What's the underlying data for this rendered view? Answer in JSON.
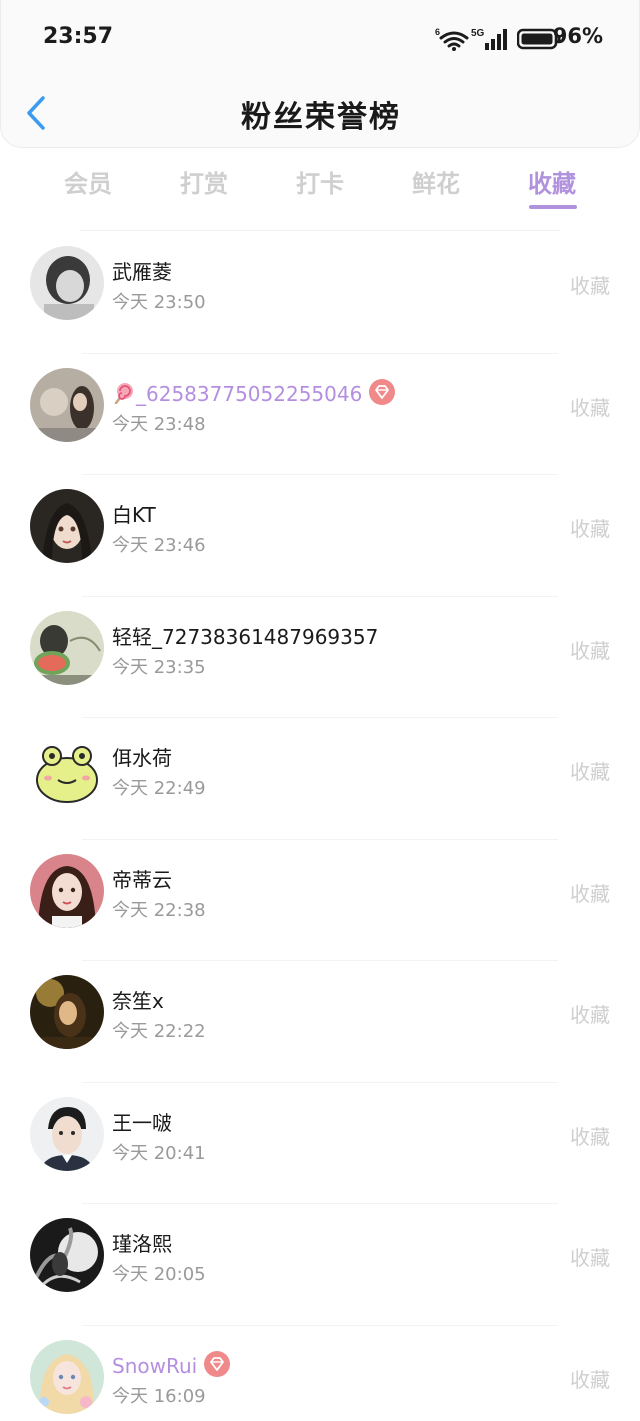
{
  "status": {
    "time": "23:57",
    "network": "5G",
    "battery": "96%"
  },
  "header": {
    "title": "粉丝荣誉榜",
    "back_icon": "chevron-left-icon"
  },
  "tabs": [
    {
      "label": "会员",
      "active": false
    },
    {
      "label": "打赏",
      "active": false
    },
    {
      "label": "打卡",
      "active": false
    },
    {
      "label": "鲜花",
      "active": false
    },
    {
      "label": "收藏",
      "active": true
    }
  ],
  "colors": {
    "accent": "#b192dc",
    "vip_name": "#b48fe0",
    "badge": "#f08a8a",
    "muted": "#cfcfcf"
  },
  "list": [
    {
      "name": "武雁菱",
      "time": "今天 23:50",
      "action": "收藏",
      "vip": false
    },
    {
      "name": "_62583775052255046",
      "time": "今天 23:48",
      "action": "收藏",
      "vip": true,
      "prefix_icon": "lollipop-icon"
    },
    {
      "name": "白KT",
      "time": "今天 23:46",
      "action": "收藏",
      "vip": false
    },
    {
      "name": "轻轻_72738361487969357",
      "time": "今天 23:35",
      "action": "收藏",
      "vip": false
    },
    {
      "name": "佴水荷",
      "time": "今天 22:49",
      "action": "收藏",
      "vip": false
    },
    {
      "name": "帝蒂云",
      "time": "今天 22:38",
      "action": "收藏",
      "vip": false
    },
    {
      "name": "奈笙x",
      "time": "今天 22:22",
      "action": "收藏",
      "vip": false
    },
    {
      "name": "王一啵",
      "time": "今天 20:41",
      "action": "收藏",
      "vip": false
    },
    {
      "name": "瑾洛熙",
      "time": "今天 20:05",
      "action": "收藏",
      "vip": false
    },
    {
      "name": "SnowRui",
      "time": "今天 16:09",
      "action": "收藏",
      "vip": true
    }
  ]
}
